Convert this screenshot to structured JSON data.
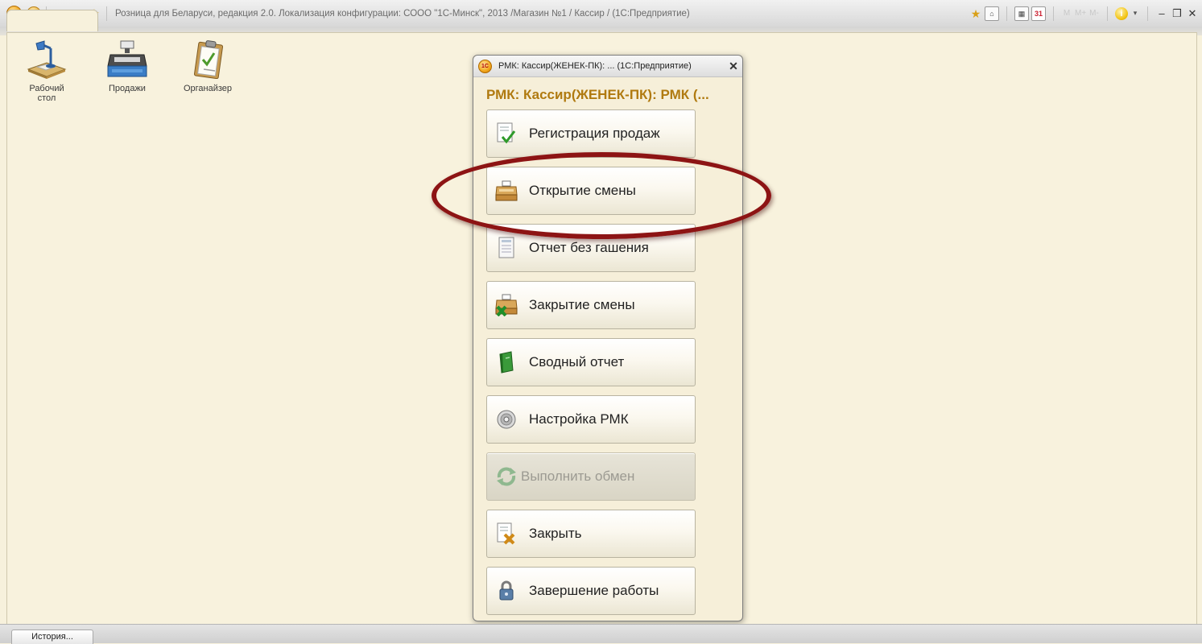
{
  "window": {
    "title": "Розница для Беларуси, редакция 2.0. Локализация конфигурации: СООО \"1С-Минск\", 2013 /Магазин №1 / Кассир /  (1С:Предприятие)"
  },
  "toolbar_right": {
    "m_labels": [
      "M",
      "M+",
      "M-"
    ]
  },
  "sections": [
    {
      "label": "Рабочий стол",
      "icon": "desk-lamp-icon"
    },
    {
      "label": "Продажи",
      "icon": "cash-register-icon"
    },
    {
      "label": "Органайзер",
      "icon": "clipboard-icon"
    }
  ],
  "dialog": {
    "title": "РМК: Кассир(ЖЕНЕК-ПК): ...  (1С:Предприятие)",
    "heading": "РМК: Кассир(ЖЕНЕК-ПК): РМК (...",
    "commands": [
      {
        "label": "Регистрация продаж",
        "icon": "document-check-icon",
        "enabled": true
      },
      {
        "label": "Открытие смены",
        "icon": "cash-register-open-icon",
        "enabled": true,
        "highlighted": true
      },
      {
        "label": "Отчет без гашения",
        "icon": "report-page-icon",
        "enabled": true
      },
      {
        "label": "Закрытие смены",
        "icon": "cash-register-close-icon",
        "enabled": true
      },
      {
        "label": "Сводный отчет",
        "icon": "green-book-icon",
        "enabled": true
      },
      {
        "label": "Настройка РМК",
        "icon": "settings-disc-icon",
        "enabled": true
      },
      {
        "label": "Выполнить обмен",
        "icon": "sync-arrows-icon",
        "enabled": false
      },
      {
        "label": "Закрыть",
        "icon": "document-close-icon",
        "enabled": true
      },
      {
        "label": "Завершение работы",
        "icon": "padlock-icon",
        "enabled": true
      }
    ]
  },
  "statusbar": {
    "history_label": "История..."
  },
  "colors": {
    "heading": "#b07a10",
    "highlight_ring": "#8d1414",
    "background": "#f7f1dc"
  }
}
